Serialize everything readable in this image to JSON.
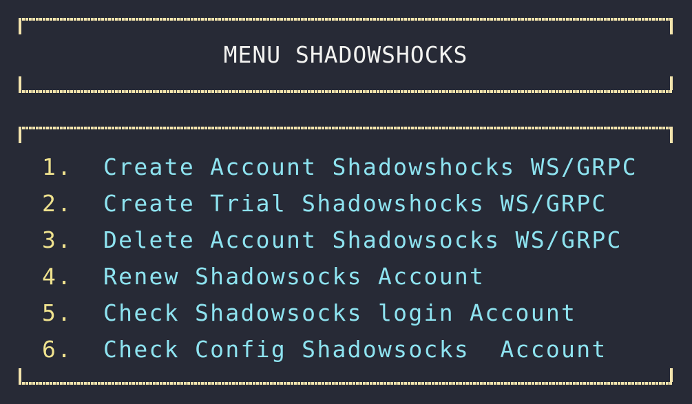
{
  "header": {
    "title": "MENU SHADOWSHOCKS"
  },
  "menu": {
    "items": [
      {
        "number": "1.",
        "label": "Create Account Shadowshocks WS/GRPC"
      },
      {
        "number": "2.",
        "label": "Create Trial Shadowshocks WS/GRPC"
      },
      {
        "number": "3.",
        "label": "Delete Account Shadowsocks WS/GRPC"
      },
      {
        "number": "4.",
        "label": "Renew Shadowsocks Account"
      },
      {
        "number": "5.",
        "label": "Check Shadowsocks login Account"
      },
      {
        "number": "6.",
        "label": "Check Config Shadowsocks  Account"
      }
    ]
  },
  "colors": {
    "background": "#272a36",
    "border": "#f3e4ad",
    "title": "#f2f2f0",
    "number": "#efe28e",
    "label": "#8ee3f0"
  }
}
